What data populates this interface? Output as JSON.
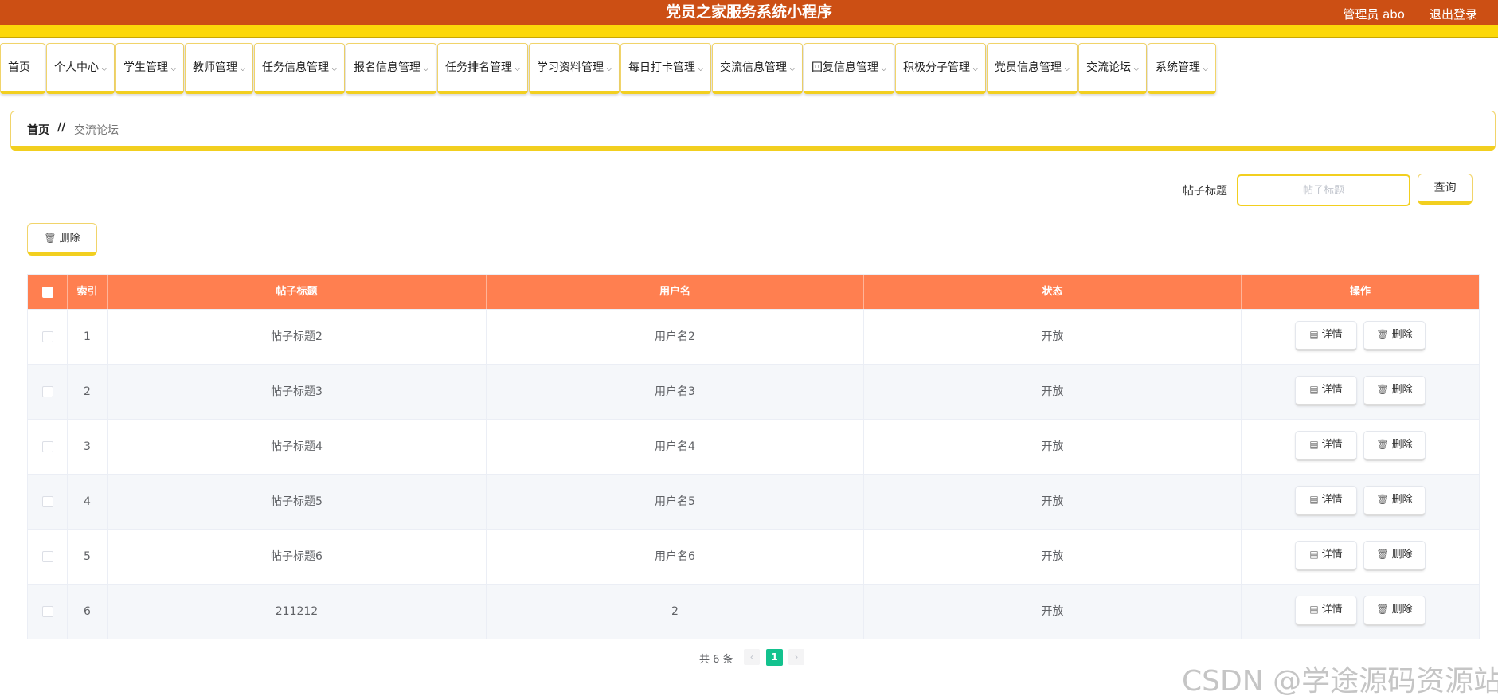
{
  "header": {
    "title": "党员之家服务系统小程序",
    "user": "管理员 abo",
    "logout": "退出登录"
  },
  "nav": [
    {
      "label": "首页",
      "has_dropdown": false
    },
    {
      "label": "个人中心",
      "has_dropdown": true
    },
    {
      "label": "学生管理",
      "has_dropdown": true
    },
    {
      "label": "教师管理",
      "has_dropdown": true
    },
    {
      "label": "任务信息管理",
      "has_dropdown": true
    },
    {
      "label": "报名信息管理",
      "has_dropdown": true
    },
    {
      "label": "任务排名管理",
      "has_dropdown": true
    },
    {
      "label": "学习资料管理",
      "has_dropdown": true
    },
    {
      "label": "每日打卡管理",
      "has_dropdown": true
    },
    {
      "label": "交流信息管理",
      "has_dropdown": true
    },
    {
      "label": "回复信息管理",
      "has_dropdown": true
    },
    {
      "label": "积极分子管理",
      "has_dropdown": true
    },
    {
      "label": "党员信息管理",
      "has_dropdown": true
    },
    {
      "label": "交流论坛",
      "has_dropdown": true
    },
    {
      "label": "系统管理",
      "has_dropdown": true
    }
  ],
  "breadcrumb": {
    "home": "首页",
    "separator": "//",
    "current": "交流论坛"
  },
  "search": {
    "label": "帖子标题",
    "placeholder": "帖子标题",
    "button": "查询"
  },
  "toolbar": {
    "delete_label": "删除"
  },
  "table": {
    "columns": [
      "索引",
      "帖子标题",
      "用户名",
      "状态",
      "操作"
    ],
    "rows": [
      {
        "index": "1",
        "title": "帖子标题2",
        "user": "用户名2",
        "status": "开放"
      },
      {
        "index": "2",
        "title": "帖子标题3",
        "user": "用户名3",
        "status": "开放"
      },
      {
        "index": "3",
        "title": "帖子标题4",
        "user": "用户名4",
        "status": "开放"
      },
      {
        "index": "4",
        "title": "帖子标题5",
        "user": "用户名5",
        "status": "开放"
      },
      {
        "index": "5",
        "title": "帖子标题6",
        "user": "用户名6",
        "status": "开放"
      },
      {
        "index": "6",
        "title": "211212",
        "user": "2",
        "status": "开放"
      }
    ],
    "detail_label": "详情",
    "delete_label": "删除"
  },
  "pagination": {
    "total_text": "共 6 条",
    "current_page": "1",
    "prev": "‹",
    "next": "›"
  },
  "watermark": "CSDN @学途源码资源站",
  "colors": {
    "header_bg": "#cc4f14",
    "accent_yellow": "#fcd809",
    "table_header": "#ff7f50",
    "page_active": "#13c28e"
  }
}
